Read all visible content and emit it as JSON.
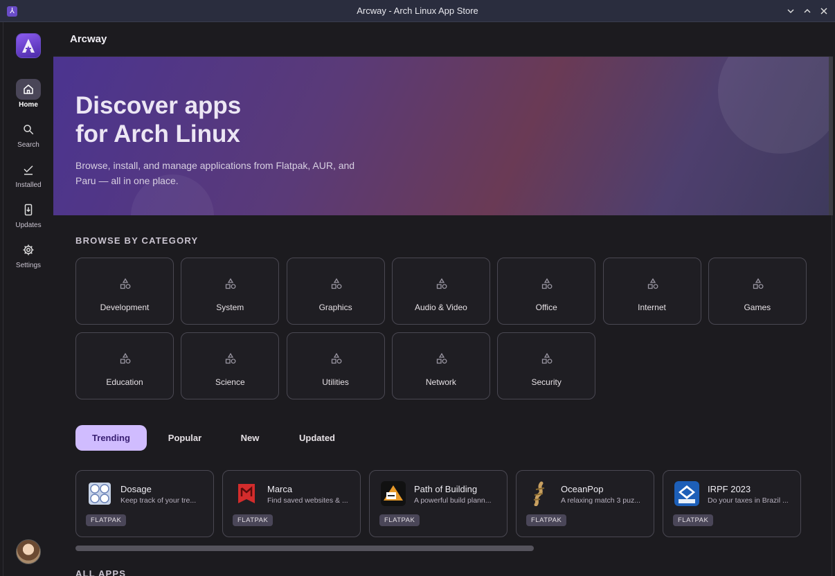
{
  "window": {
    "title": "Arcway - Arch Linux App Store"
  },
  "header": {
    "title": "Arcway"
  },
  "sidebar": {
    "items": [
      {
        "label": "Home",
        "icon": "home-icon",
        "active": true
      },
      {
        "label": "Search",
        "icon": "search-icon",
        "active": false
      },
      {
        "label": "Installed",
        "icon": "check-icon",
        "active": false
      },
      {
        "label": "Updates",
        "icon": "download-icon",
        "active": false
      },
      {
        "label": "Settings",
        "icon": "gear-icon",
        "active": false
      }
    ]
  },
  "hero": {
    "title_line1": "Discover apps",
    "title_line2": "for Arch Linux",
    "subtitle": "Browse, install, and manage applications from Flatpak, AUR, and Paru — all in one place."
  },
  "categories": {
    "title": "BROWSE BY CATEGORY",
    "items": [
      "Development",
      "System",
      "Graphics",
      "Audio & Video",
      "Office",
      "Internet",
      "Games",
      "Education",
      "Science",
      "Utilities",
      "Network",
      "Security"
    ]
  },
  "tabs": [
    {
      "label": "Trending",
      "active": true
    },
    {
      "label": "Popular",
      "active": false
    },
    {
      "label": "New",
      "active": false
    },
    {
      "label": "Updated",
      "active": false
    }
  ],
  "apps": [
    {
      "name": "Dosage",
      "desc": "Keep track of your tre...",
      "badge": "FLATPAK",
      "icon": "pills-icon"
    },
    {
      "name": "Marca",
      "desc": "Find saved websites & ...",
      "badge": "FLATPAK",
      "icon": "marca-icon"
    },
    {
      "name": "Path of Building",
      "desc": "A powerful build plann...",
      "badge": "FLATPAK",
      "icon": "path-of-building-icon"
    },
    {
      "name": "OceanPop",
      "desc": "A relaxing match 3 puz...",
      "badge": "FLATPAK",
      "icon": "oceanpop-icon"
    },
    {
      "name": "IRPF 2023",
      "desc": "Do your taxes in Brazil ...",
      "badge": "FLATPAK",
      "icon": "irpf-icon"
    }
  ],
  "all_apps": {
    "title": "ALL APPS"
  },
  "colors": {
    "accent": "#d0bcff",
    "background": "#1c1b1f",
    "card_border": "#4a4852"
  }
}
